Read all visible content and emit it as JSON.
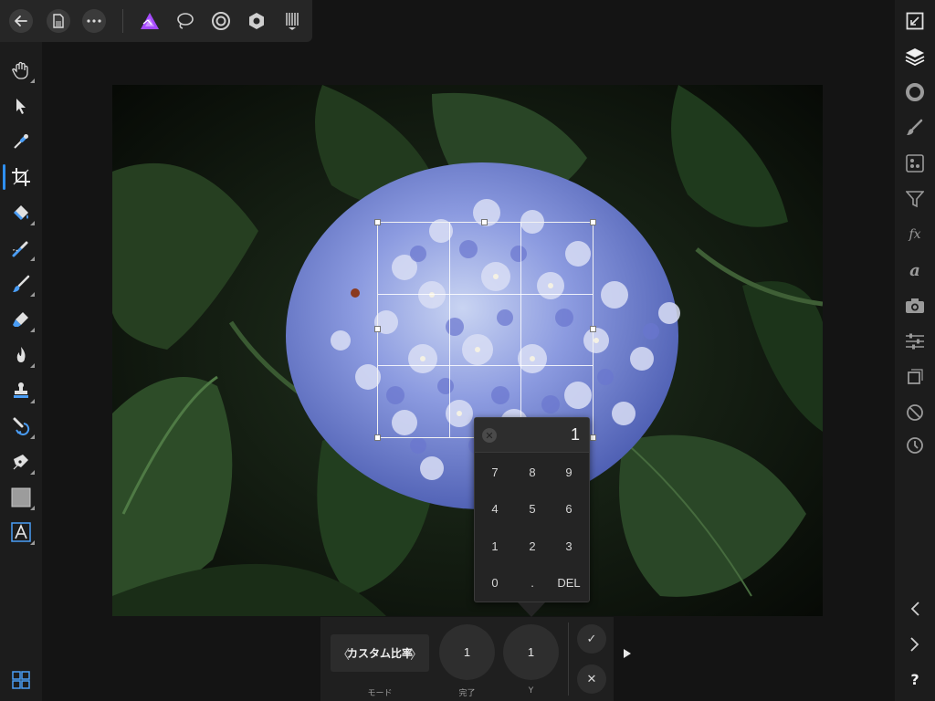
{
  "top_toolbar": {
    "buttons": [
      "back-icon",
      "document-icon",
      "more-icon"
    ],
    "personas": [
      "photo-persona-icon",
      "liquify-persona-icon",
      "develop-persona-icon",
      "tone-mapping-persona-icon",
      "export-persona-icon"
    ],
    "accent_color": "#a64bff"
  },
  "left_tools": [
    "hand-icon",
    "move-icon",
    "color-picker-icon",
    "crop-icon",
    "flood-fill-icon",
    "selection-brush-icon",
    "paint-brush-icon",
    "eraser-icon",
    "dodge-burn-icon",
    "clone-stamp-icon",
    "healing-icon",
    "pen-icon",
    "rectangle-icon",
    "artistic-text-icon"
  ],
  "active_tool": "crop-icon",
  "right_studio": [
    "navigator-icon",
    "layers-icon",
    "color-icon",
    "brushes-icon",
    "channels-icon",
    "filters-icon",
    "fx-icon",
    "text-styles-icon",
    "snapshots-icon",
    "adjustments-icon",
    "transform-icon",
    "history-mask-icon",
    "history-icon"
  ],
  "right_bottom": {
    "prev": "chevron-left-icon",
    "next": "chevron-right-icon",
    "help": "?"
  },
  "keypad": {
    "value": "1",
    "keys": [
      "7",
      "8",
      "9",
      "4",
      "5",
      "6",
      "1",
      "2",
      "3",
      "0",
      ".",
      "DEL"
    ]
  },
  "context_toolbar": {
    "mode": {
      "value": "カスタム比率",
      "label": "モード"
    },
    "dial1": {
      "value": "1",
      "label": "完了"
    },
    "dial2": {
      "value": "1",
      "label": "Y"
    },
    "confirm": "✓",
    "cancel": "✕"
  }
}
